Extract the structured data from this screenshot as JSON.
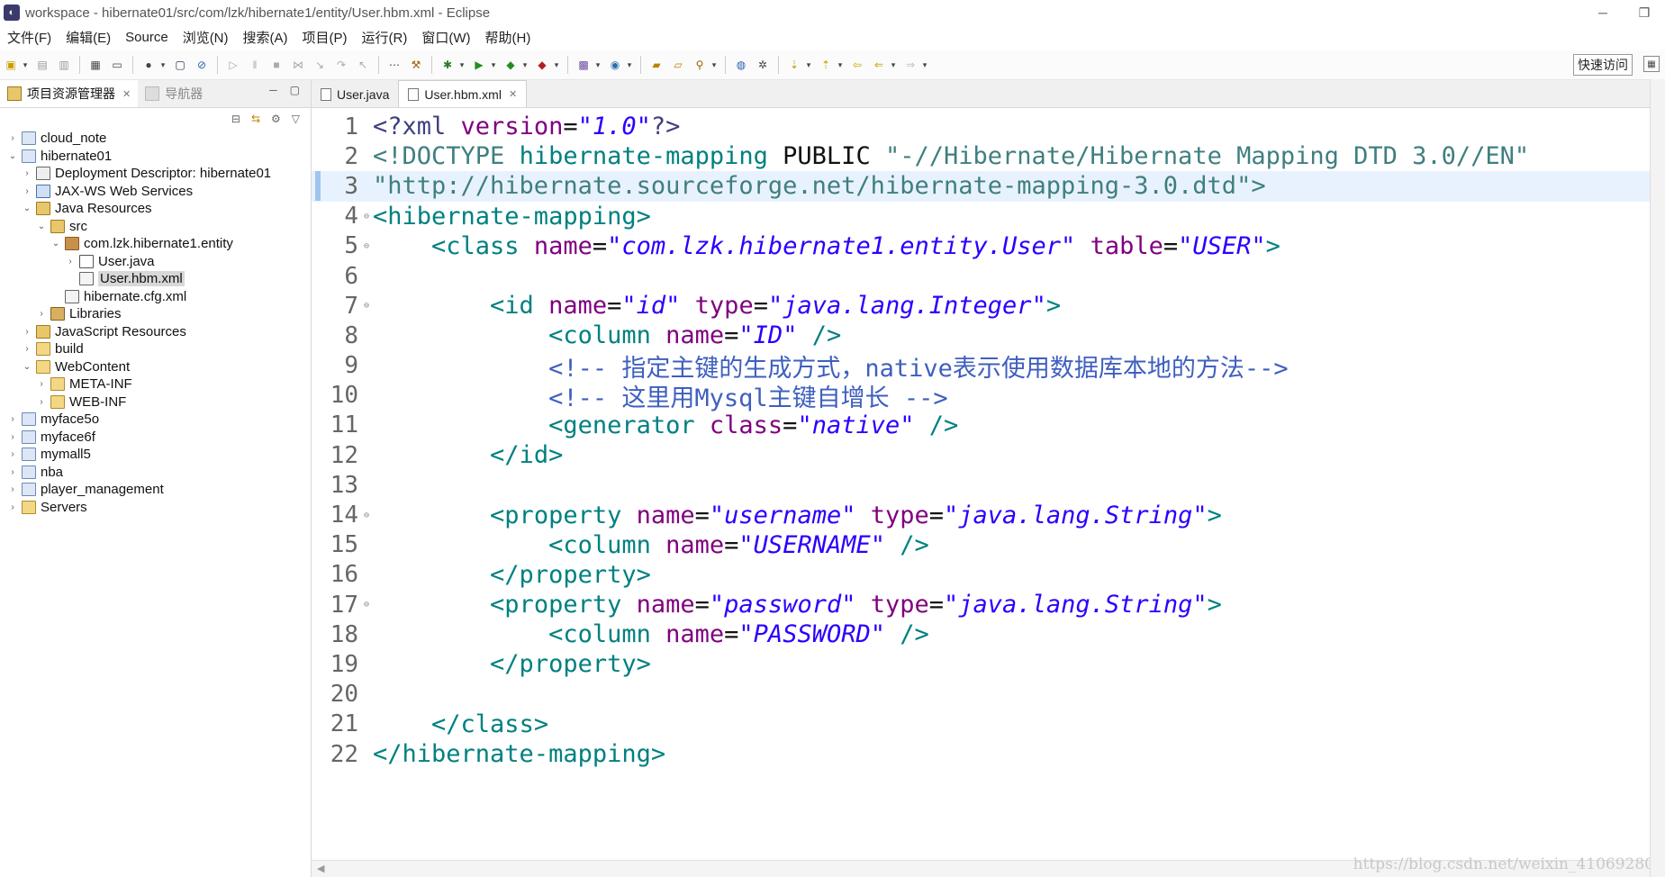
{
  "window": {
    "title": "workspace - hibernate01/src/com/lzk/hibernate1/entity/User.hbm.xml - Eclipse",
    "min": "─",
    "restore": "❐"
  },
  "menu": [
    "文件(F)",
    "编辑(E)",
    "Source",
    "浏览(N)",
    "搜索(A)",
    "项目(P)",
    "运行(R)",
    "窗口(W)",
    "帮助(H)"
  ],
  "toolbar": {
    "quick_access": "快速访问"
  },
  "project_explorer": {
    "tab_label": "项目资源管理器",
    "navigator_label": "导航器",
    "tree": [
      {
        "label": "cloud_note",
        "indent": 0,
        "arrow": "›",
        "icon": "project-icon"
      },
      {
        "label": "hibernate01",
        "indent": 0,
        "arrow": "⌄",
        "icon": "project-icon"
      },
      {
        "label": "Deployment Descriptor: hibernate01",
        "indent": 1,
        "arrow": "›",
        "icon": "deployment-descriptor-icon"
      },
      {
        "label": "JAX-WS Web Services",
        "indent": 1,
        "arrow": "›",
        "icon": "web-services-icon"
      },
      {
        "label": "Java Resources",
        "indent": 1,
        "arrow": "⌄",
        "icon": "java-resources-icon"
      },
      {
        "label": "src",
        "indent": 2,
        "arrow": "⌄",
        "icon": "source-folder-icon"
      },
      {
        "label": "com.lzk.hibernate1.entity",
        "indent": 3,
        "arrow": "⌄",
        "icon": "package-icon"
      },
      {
        "label": "User.java",
        "indent": 4,
        "arrow": "›",
        "icon": "java-file-icon"
      },
      {
        "label": "User.hbm.xml",
        "indent": 4,
        "arrow": "",
        "icon": "xml-file-icon",
        "selected": true
      },
      {
        "label": "hibernate.cfg.xml",
        "indent": 3,
        "arrow": "",
        "icon": "xml-file-icon"
      },
      {
        "label": "Libraries",
        "indent": 2,
        "arrow": "›",
        "icon": "libraries-icon"
      },
      {
        "label": "JavaScript Resources",
        "indent": 1,
        "arrow": "›",
        "icon": "javascript-resources-icon"
      },
      {
        "label": "build",
        "indent": 1,
        "arrow": "›",
        "icon": "folder-icon"
      },
      {
        "label": "WebContent",
        "indent": 1,
        "arrow": "⌄",
        "icon": "folder-icon"
      },
      {
        "label": "META-INF",
        "indent": 2,
        "arrow": "›",
        "icon": "folder-icon"
      },
      {
        "label": "WEB-INF",
        "indent": 2,
        "arrow": "›",
        "icon": "folder-icon"
      },
      {
        "label": "myface5o",
        "indent": 0,
        "arrow": "›",
        "icon": "project-icon"
      },
      {
        "label": "myface6f",
        "indent": 0,
        "arrow": "›",
        "icon": "project-icon"
      },
      {
        "label": "mymall5",
        "indent": 0,
        "arrow": "›",
        "icon": "project-icon"
      },
      {
        "label": "nba",
        "indent": 0,
        "arrow": "›",
        "icon": "project-icon"
      },
      {
        "label": "player_management",
        "indent": 0,
        "arrow": "›",
        "icon": "project-icon"
      },
      {
        "label": "Servers",
        "indent": 0,
        "arrow": "›",
        "icon": "folder-icon"
      }
    ]
  },
  "editor": {
    "tabs": [
      {
        "label": "User.java",
        "active": false
      },
      {
        "label": "User.hbm.xml",
        "active": true
      }
    ],
    "current_line": 3,
    "lines": [
      {
        "n": "1",
        "fold": "",
        "tokens": [
          [
            "pi",
            "<?xml "
          ],
          [
            "attr",
            "version"
          ],
          [
            "plain",
            "="
          ],
          [
            "stri",
            "\"1.0\""
          ],
          [
            "pi",
            "?>"
          ]
        ]
      },
      {
        "n": "2",
        "fold": "",
        "tokens": [
          [
            "doct",
            "<!DOCTYPE "
          ],
          [
            "tag",
            "hibernate-mapping"
          ],
          [
            "plain",
            " PUBLIC "
          ],
          [
            "doct",
            "\"-//Hibernate/Hibernate Mapping DTD 3.0//EN\""
          ]
        ]
      },
      {
        "n": "3",
        "fold": "",
        "tokens": [
          [
            "doct",
            "\"http://hibernate.sourceforge.net/hibernate-mapping-3.0.dtd\""
          ],
          [
            "doct",
            ">"
          ]
        ]
      },
      {
        "n": "4",
        "fold": "⊖",
        "tokens": [
          [
            "tag",
            "<hibernate-mapping>"
          ]
        ]
      },
      {
        "n": "5",
        "fold": "⊖",
        "tokens": [
          [
            "plain",
            "    "
          ],
          [
            "tag",
            "<class "
          ],
          [
            "attr",
            "name"
          ],
          [
            "plain",
            "="
          ],
          [
            "stri",
            "\"com.lzk.hibernate1.entity.User\""
          ],
          [
            "plain",
            " "
          ],
          [
            "attr",
            "table"
          ],
          [
            "plain",
            "="
          ],
          [
            "stri",
            "\"USER\""
          ],
          [
            "tag",
            ">"
          ]
        ]
      },
      {
        "n": "6",
        "fold": "",
        "tokens": []
      },
      {
        "n": "7",
        "fold": "⊖",
        "tokens": [
          [
            "plain",
            "        "
          ],
          [
            "tag",
            "<id "
          ],
          [
            "attr",
            "name"
          ],
          [
            "plain",
            "="
          ],
          [
            "stri",
            "\"id\""
          ],
          [
            "plain",
            " "
          ],
          [
            "attr",
            "type"
          ],
          [
            "plain",
            "="
          ],
          [
            "stri",
            "\"java.lang.Integer\""
          ],
          [
            "tag",
            ">"
          ]
        ]
      },
      {
        "n": "8",
        "fold": "",
        "tokens": [
          [
            "plain",
            "            "
          ],
          [
            "tag",
            "<column "
          ],
          [
            "attr",
            "name"
          ],
          [
            "plain",
            "="
          ],
          [
            "stri",
            "\"ID\""
          ],
          [
            "plain",
            " "
          ],
          [
            "tag",
            "/>"
          ]
        ]
      },
      {
        "n": "9",
        "fold": "",
        "tokens": [
          [
            "plain",
            "            "
          ],
          [
            "cmt",
            "<!-- 指定主键的生成方式，native表示使用数据库本地的方法-->"
          ]
        ]
      },
      {
        "n": "10",
        "fold": "",
        "tokens": [
          [
            "plain",
            "            "
          ],
          [
            "cmt",
            "<!-- 这里用Mysql主键自增长 -->"
          ]
        ]
      },
      {
        "n": "11",
        "fold": "",
        "tokens": [
          [
            "plain",
            "            "
          ],
          [
            "tag",
            "<generator "
          ],
          [
            "attr",
            "class"
          ],
          [
            "plain",
            "="
          ],
          [
            "stri",
            "\"native\""
          ],
          [
            "plain",
            " "
          ],
          [
            "tag",
            "/>"
          ]
        ]
      },
      {
        "n": "12",
        "fold": "",
        "tokens": [
          [
            "plain",
            "        "
          ],
          [
            "tag",
            "</id>"
          ]
        ]
      },
      {
        "n": "13",
        "fold": "",
        "tokens": []
      },
      {
        "n": "14",
        "fold": "⊖",
        "tokens": [
          [
            "plain",
            "        "
          ],
          [
            "tag",
            "<property "
          ],
          [
            "attr",
            "name"
          ],
          [
            "plain",
            "="
          ],
          [
            "stri",
            "\"username\""
          ],
          [
            "plain",
            " "
          ],
          [
            "attr",
            "type"
          ],
          [
            "plain",
            "="
          ],
          [
            "stri",
            "\"java.lang.String\""
          ],
          [
            "tag",
            ">"
          ]
        ]
      },
      {
        "n": "15",
        "fold": "",
        "tokens": [
          [
            "plain",
            "            "
          ],
          [
            "tag",
            "<column "
          ],
          [
            "attr",
            "name"
          ],
          [
            "plain",
            "="
          ],
          [
            "stri",
            "\"USERNAME\""
          ],
          [
            "plain",
            " "
          ],
          [
            "tag",
            "/>"
          ]
        ]
      },
      {
        "n": "16",
        "fold": "",
        "tokens": [
          [
            "plain",
            "        "
          ],
          [
            "tag",
            "</property>"
          ]
        ]
      },
      {
        "n": "17",
        "fold": "⊖",
        "tokens": [
          [
            "plain",
            "        "
          ],
          [
            "tag",
            "<property "
          ],
          [
            "attr",
            "name"
          ],
          [
            "plain",
            "="
          ],
          [
            "stri",
            "\"password\""
          ],
          [
            "plain",
            " "
          ],
          [
            "attr",
            "type"
          ],
          [
            "plain",
            "="
          ],
          [
            "stri",
            "\"java.lang.String\""
          ],
          [
            "tag",
            ">"
          ]
        ]
      },
      {
        "n": "18",
        "fold": "",
        "tokens": [
          [
            "plain",
            "            "
          ],
          [
            "tag",
            "<column "
          ],
          [
            "attr",
            "name"
          ],
          [
            "plain",
            "="
          ],
          [
            "stri",
            "\"PASSWORD\""
          ],
          [
            "plain",
            " "
          ],
          [
            "tag",
            "/>"
          ]
        ]
      },
      {
        "n": "19",
        "fold": "",
        "tokens": [
          [
            "plain",
            "        "
          ],
          [
            "tag",
            "</property>"
          ]
        ]
      },
      {
        "n": "20",
        "fold": "",
        "tokens": []
      },
      {
        "n": "21",
        "fold": "",
        "tokens": [
          [
            "plain",
            "    "
          ],
          [
            "tag",
            "</class>"
          ]
        ]
      },
      {
        "n": "22",
        "fold": "",
        "tokens": [
          [
            "tag",
            "</hibernate-mapping>"
          ]
        ]
      }
    ]
  },
  "watermark": "https://blog.csdn.net/weixin_41069280"
}
